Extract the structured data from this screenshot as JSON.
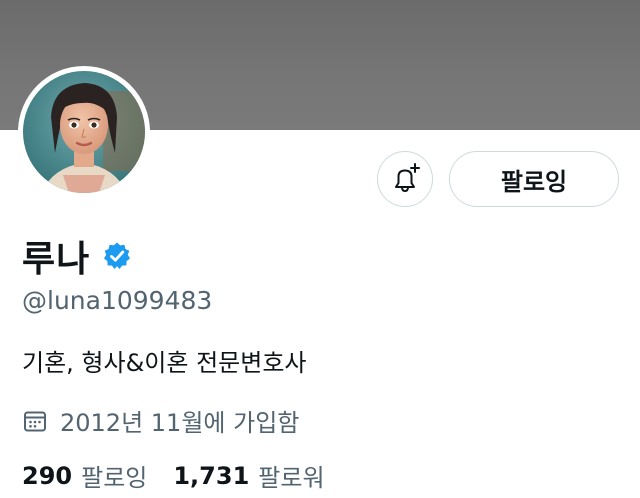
{
  "profile": {
    "name": "루나",
    "handle": "@luna1099483",
    "bio": "기혼, 형사&이혼 전문변호사",
    "joined": "2012년 11월에 가입함",
    "verified": true
  },
  "buttons": {
    "follow_label": "팔로잉",
    "notify_icon": "bell-plus-icon"
  },
  "stats": {
    "following_count": "290",
    "following_label": "팔로잉",
    "followers_count": "1,731",
    "followers_label": "팔로워"
  },
  "colors": {
    "banner": "#737373",
    "verified_badge": "#1d9bf0",
    "secondary_text": "#536471",
    "primary_text": "#0f1419",
    "button_border": "#cfd9de"
  }
}
